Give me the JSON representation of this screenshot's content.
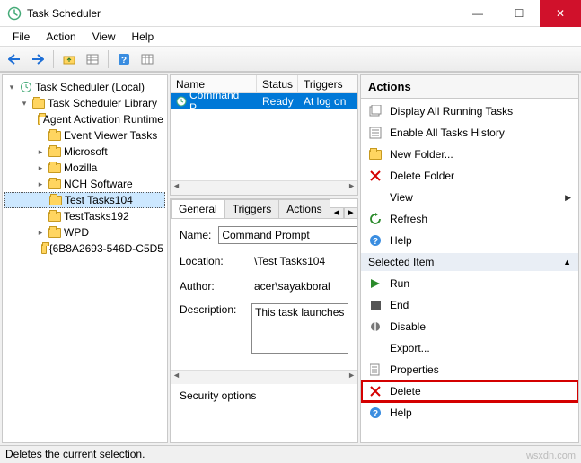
{
  "window": {
    "title": "Task Scheduler",
    "min": "—",
    "max": "☐",
    "close": "✕"
  },
  "menu": {
    "file": "File",
    "action": "Action",
    "view": "View",
    "help": "Help"
  },
  "tree": {
    "root": "Task Scheduler (Local)",
    "library": "Task Scheduler Library",
    "items": [
      "Agent Activation Runtime",
      "Event Viewer Tasks",
      "Microsoft",
      "Mozilla",
      "NCH Software",
      "Test Tasks104",
      "TestTasks192",
      "WPD",
      "{6B8A2693-546D-C5D5"
    ]
  },
  "list": {
    "cols": {
      "name": "Name",
      "status": "Status",
      "triggers": "Triggers"
    },
    "row": {
      "name": "Command P...",
      "status": "Ready",
      "triggers": "At log on"
    }
  },
  "tabs": {
    "general": "General",
    "triggers": "Triggers",
    "actions": "Actions"
  },
  "detail": {
    "name_label": "Name:",
    "name_value": "Command Prompt",
    "location_label": "Location:",
    "location_value": "\\Test Tasks104",
    "author_label": "Author:",
    "author_value": "acer\\sayakboral",
    "desc_label": "Description:",
    "desc_value": "This task launches",
    "security_label": "Security options"
  },
  "actions": {
    "header": "Actions",
    "group2": "Selected Item",
    "items1": [
      "Display All Running Tasks",
      "Enable All Tasks History",
      "New Folder...",
      "Delete Folder",
      "View",
      "Refresh",
      "Help"
    ],
    "items2": [
      "Run",
      "End",
      "Disable",
      "Export...",
      "Properties",
      "Delete",
      "Help"
    ]
  },
  "status": "Deletes the current selection.",
  "watermark": "wsxdn.com"
}
